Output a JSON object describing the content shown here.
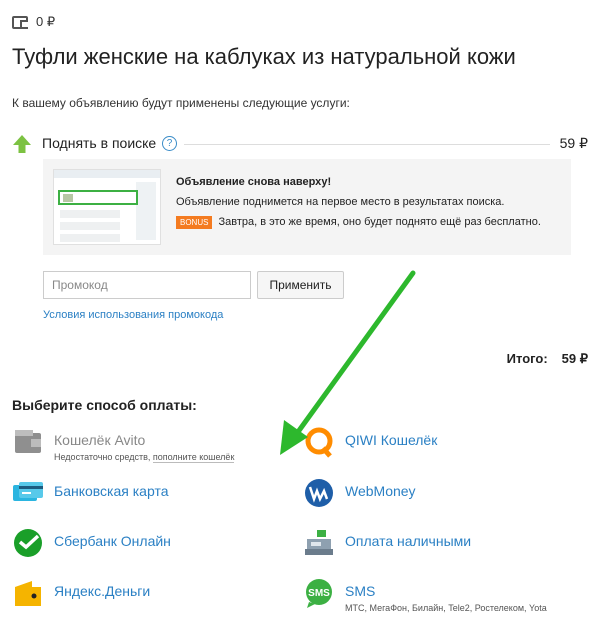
{
  "wallet": {
    "icon": "wallet-icon",
    "balance": "0 ₽"
  },
  "page": {
    "title": "Туфли женские на каблуках из натуральной кожи",
    "intro": "К вашему объявлению будут применены следующие услуги:"
  },
  "service": {
    "icon": "up-arrow-icon",
    "label": "Поднять в поиске",
    "help": "?",
    "price": "59 ₽",
    "preview_title": "Объявление снова наверху!",
    "preview_text": "Объявление поднимется на первое место в результатах поиска.",
    "bonus_badge": "Bonus",
    "bonus_text": "Завтра, в это же время, оно будет поднято ещё раз бесплатно."
  },
  "promo": {
    "placeholder": "Промокод",
    "apply_label": "Применить",
    "terms_link": "Условия использования промокода"
  },
  "total": {
    "label": "Итого:",
    "value": "59 ₽"
  },
  "payment": {
    "heading": "Выберите способ оплаты:",
    "methods": [
      {
        "label": "Кошелёк Avito",
        "sub_prefix": "Недостаточно средств,",
        "sub_link": "пополните кошелёк",
        "icon": "avito-wallet-icon",
        "color": "#9a9a9a"
      },
      {
        "label": "QIWI Кошелёк",
        "icon": "qiwi-icon",
        "color": "#ff8c00"
      },
      {
        "label": "Банковская карта",
        "icon": "bank-card-icon",
        "color": "#2bb5e0"
      },
      {
        "label": "WebMoney",
        "icon": "webmoney-icon",
        "color": "#1e5ea8"
      },
      {
        "label": "Сбербанк Онлайн",
        "icon": "sberbank-icon",
        "color": "#1a9f29"
      },
      {
        "label": "Оплата наличными",
        "icon": "cash-register-icon",
        "color": "#6b7c8c"
      },
      {
        "label": "Яндекс.Деньги",
        "icon": "yandex-money-icon",
        "color": "#f5b400"
      },
      {
        "label": "SMS",
        "sub": "МТС, МегаФон, Билайн, Tele2, Ростелеком, Yota",
        "icon": "sms-icon",
        "color": "#3cb043"
      }
    ]
  }
}
